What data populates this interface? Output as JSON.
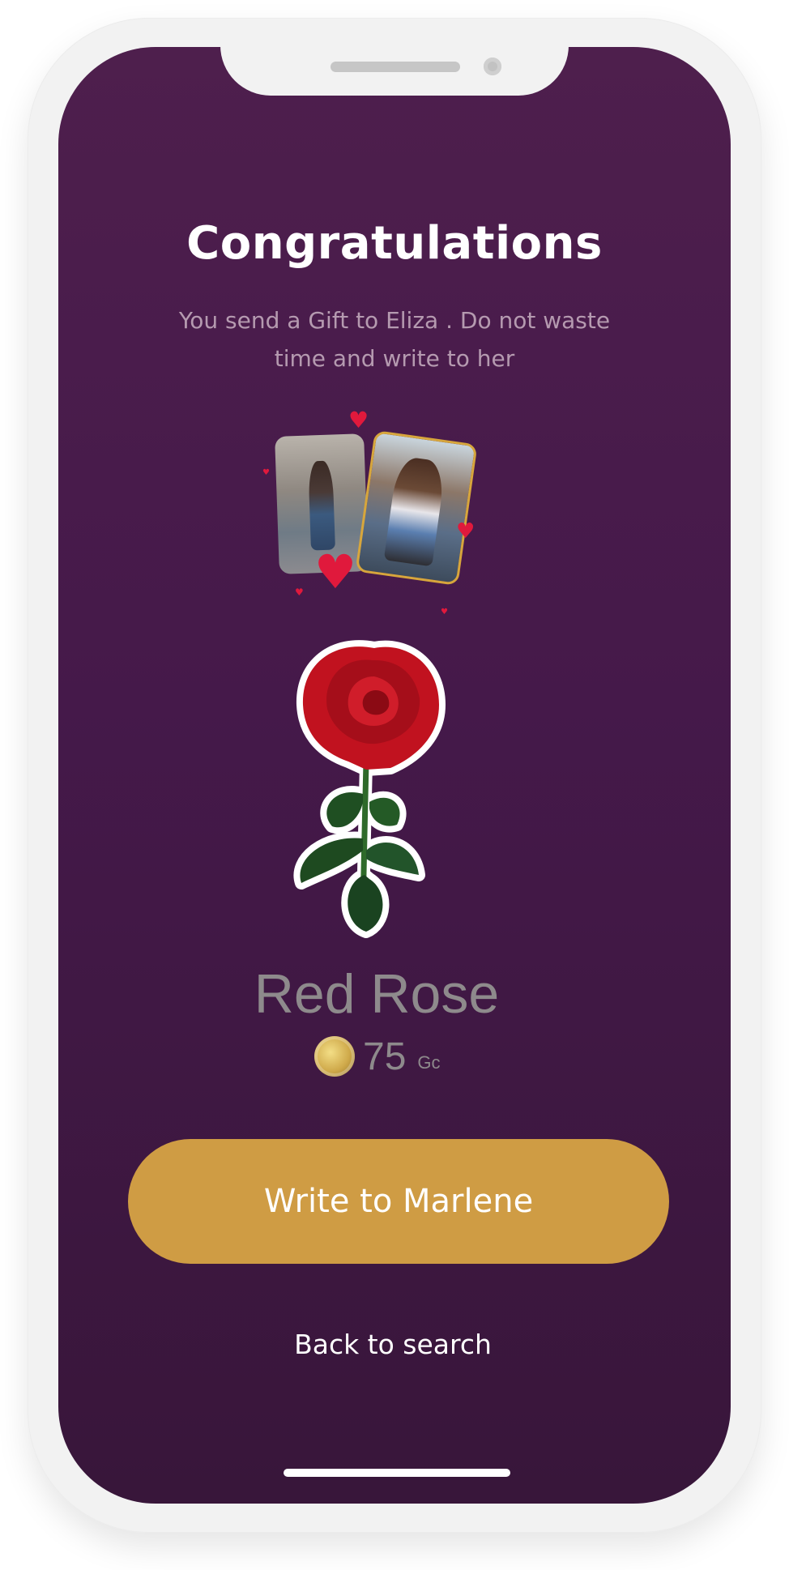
{
  "header": {
    "title": "Congratulations",
    "message": "You send a Gift to Eliza  . Do not waste time and write to her"
  },
  "gift": {
    "name": "Red Rose",
    "price": "75",
    "currency": "Gc",
    "image": "red-rose-sticker",
    "coin_icon": "gold-coin-icon"
  },
  "actions": {
    "write_label": "Write to Marlene",
    "back_label": "Back to search"
  },
  "colors": {
    "background_top": "#4e1f4d",
    "background_bottom": "#38163a",
    "accent": "#cf9c44",
    "heart": "#e0193c"
  }
}
